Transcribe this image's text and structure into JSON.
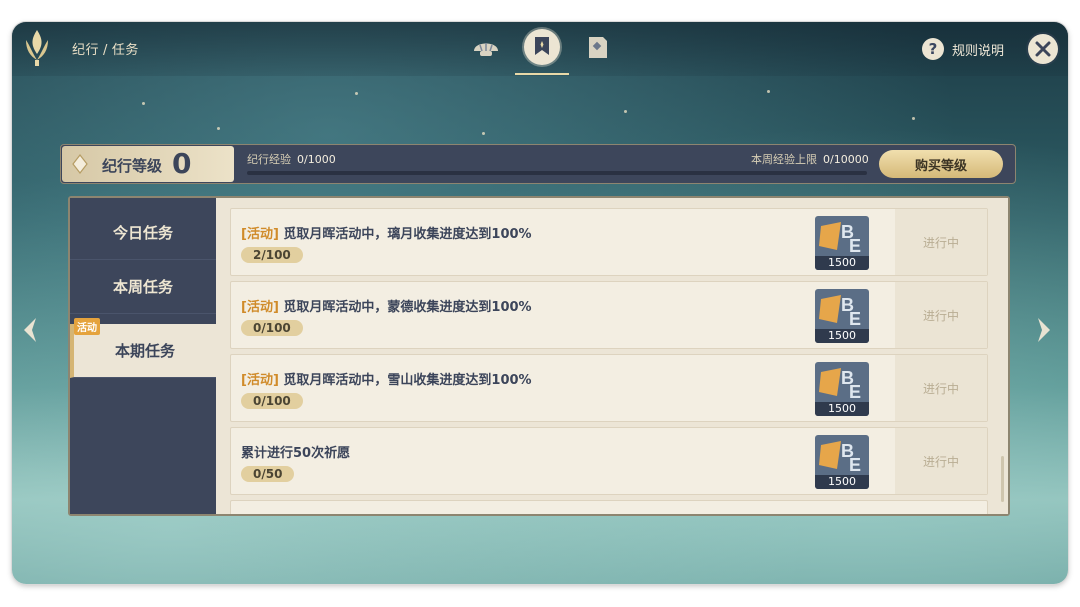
{
  "header": {
    "breadcrumb": [
      "纪行",
      "任务"
    ],
    "breadcrumb_sep": "/",
    "tabs": [
      {
        "name": "shell-tab",
        "icon": "shell-icon"
      },
      {
        "name": "mission-tab",
        "icon": "banner-icon",
        "active": true
      },
      {
        "name": "shop-tab",
        "icon": "card-icon"
      }
    ],
    "help_label": "规则说明",
    "help_glyph": "?",
    "close_glyph": "✕"
  },
  "level": {
    "label": "纪行等级",
    "value": "0",
    "exp_label": "纪行经验",
    "exp_value": "0/1000",
    "weekly_label": "本周经验上限",
    "weekly_value": "0/10000",
    "buy_label": "购买等级"
  },
  "sidebar": {
    "tabs": [
      {
        "label": "今日任务"
      },
      {
        "label": "本周任务"
      },
      {
        "label": "本期任务",
        "badge": "活动",
        "active": true
      }
    ]
  },
  "missions": [
    {
      "tag": "[活动]",
      "title": "觅取月晖活动中，璃月收集进度达到100%",
      "progress": "2/100",
      "reward": "1500",
      "status": "进行中"
    },
    {
      "tag": "[活动]",
      "title": "觅取月晖活动中，蒙德收集进度达到100%",
      "progress": "0/100",
      "reward": "1500",
      "status": "进行中"
    },
    {
      "tag": "[活动]",
      "title": "觅取月晖活动中，雪山收集进度达到100%",
      "progress": "0/100",
      "reward": "1500",
      "status": "进行中"
    },
    {
      "tag": "",
      "title": "累计进行50次祈愿",
      "progress": "0/50",
      "reward": "1500",
      "status": "进行中"
    }
  ],
  "colors": {
    "panel": "#3d465b",
    "list_bg": "#ece5d6",
    "accent_gold": "#d5b978",
    "tag_orange": "#d08b2a"
  }
}
